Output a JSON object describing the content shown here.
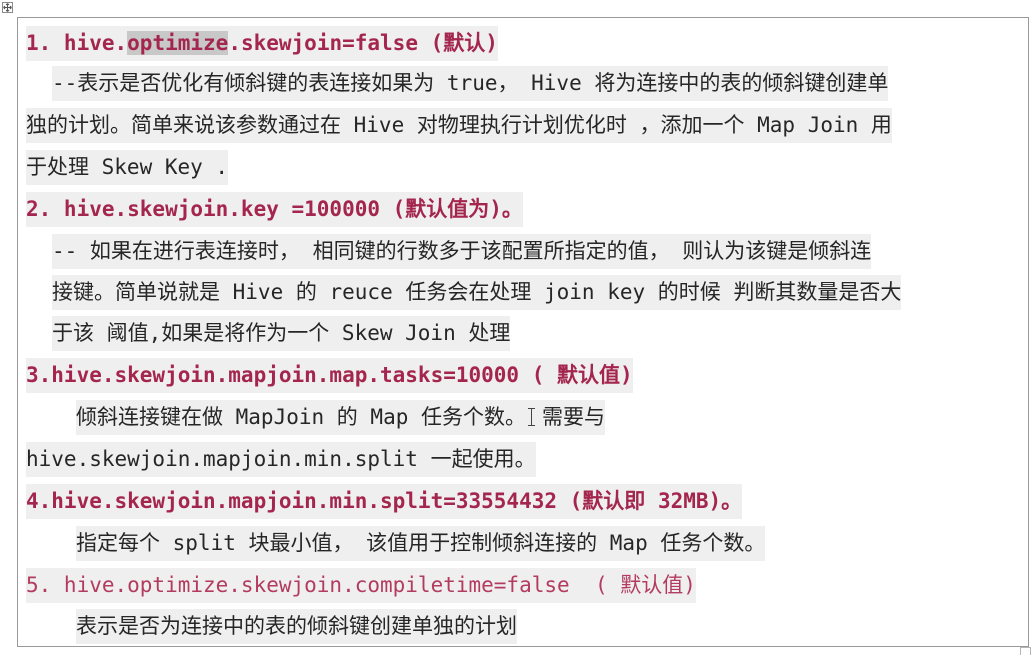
{
  "lines": {
    "l1": {
      "prefix": "1. hive.",
      "selected": "optimize",
      "suffix": ".skewjoin=false (默认)"
    },
    "l2": "--表示是否优化有倾斜键的表连接如果为 true， Hive 将为连接中的表的倾斜键创建单",
    "l3": "独的计划。简单来说该参数通过在 Hive 对物理执行计划优化时 ，添加一个 Map Join 用",
    "l4": "于处理 Skew Key .",
    "l5": "2. hive.skewjoin.key =100000 (默认值为)。",
    "l6": "-- 如果在进行表连接时， 相同键的行数多于该配置所指定的值， 则认为该键是倾斜连",
    "l7": "接键。简单说就是 Hive 的 reuce 任务会在处理 join key 的时候 判断其数量是否大",
    "l8": "于该 阈值,如果是将作为一个 Skew Join 处理",
    "l9": "3.hive.skewjoin.mapjoin.map.tasks=10000 ( 默认值)",
    "l10": {
      "before": "倾斜连接键在做 MapJoin 的 Map 任务个数。",
      "after": "需要与"
    },
    "l11": "hive.skewjoin.mapjoin.min.split 一起使用。",
    "l12": "4.hive.skewjoin.mapjoin.min.split=33554432 (默认即 32MB)。",
    "l13": "指定每个 split 块最小值， 该值用于控制倾斜连接的 Map 任务个数。",
    "l14": "5. hive.optimize.skewjoin.compiletime=false  ( 默认值)",
    "l15": "表示是否为连接中的表的倾斜键创建单独的计划"
  }
}
